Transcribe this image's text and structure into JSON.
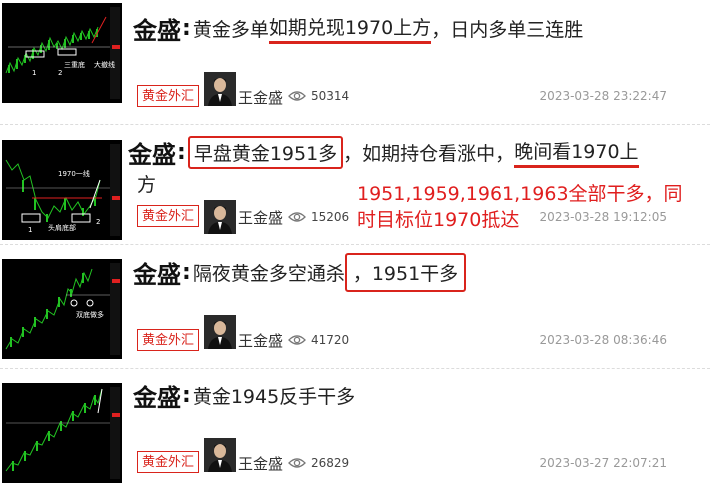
{
  "articles": [
    {
      "brand": "金盛",
      "colon": ":",
      "title_parts": [
        "黄金多单",
        "如期兑现1970上方",
        "，日内多单三连胜"
      ],
      "tag": "黄金外汇",
      "author": "王金盛",
      "views": "50314",
      "time": "2023-03-28 23:22:47",
      "thumb_labels": [
        "1",
        "2",
        "三重底",
        "大撤线"
      ]
    },
    {
      "brand": "金盛",
      "colon": ":",
      "title_parts": [
        "早盘黄金1951多",
        "，如期持仓看涨中，",
        "晚间看1970上"
      ],
      "title_wrap": "方",
      "tag": "黄金外汇",
      "author": "王金盛",
      "views": "15206",
      "time": "2023-03-28 19:12:05",
      "note": "1951,1959,1961,1963全部干多，同时目标位1970抵达",
      "thumb_labels": [
        "1970一线",
        "头肩底部",
        "2",
        "1"
      ]
    },
    {
      "brand": "金盛",
      "colon": ":",
      "title_parts": [
        "隔夜黄金多空通杀",
        "，1951干多"
      ],
      "tag": "黄金外汇",
      "author": "王金盛",
      "views": "41720",
      "time": "2023-03-28 08:36:46",
      "thumb_labels": [
        "双底做多"
      ]
    },
    {
      "brand": "金盛",
      "colon": ":",
      "title_parts": [
        "黄金1945反手干多"
      ],
      "tag": "黄金外汇",
      "author": "王金盛",
      "views": "26829",
      "time": "2023-03-27 22:07:21"
    }
  ],
  "colors": {
    "accent_red": "#d9241c",
    "candle_up": "#22c322",
    "background": "#ffffff"
  },
  "icons": {
    "views": "eye-icon",
    "avatar": "author-avatar"
  }
}
